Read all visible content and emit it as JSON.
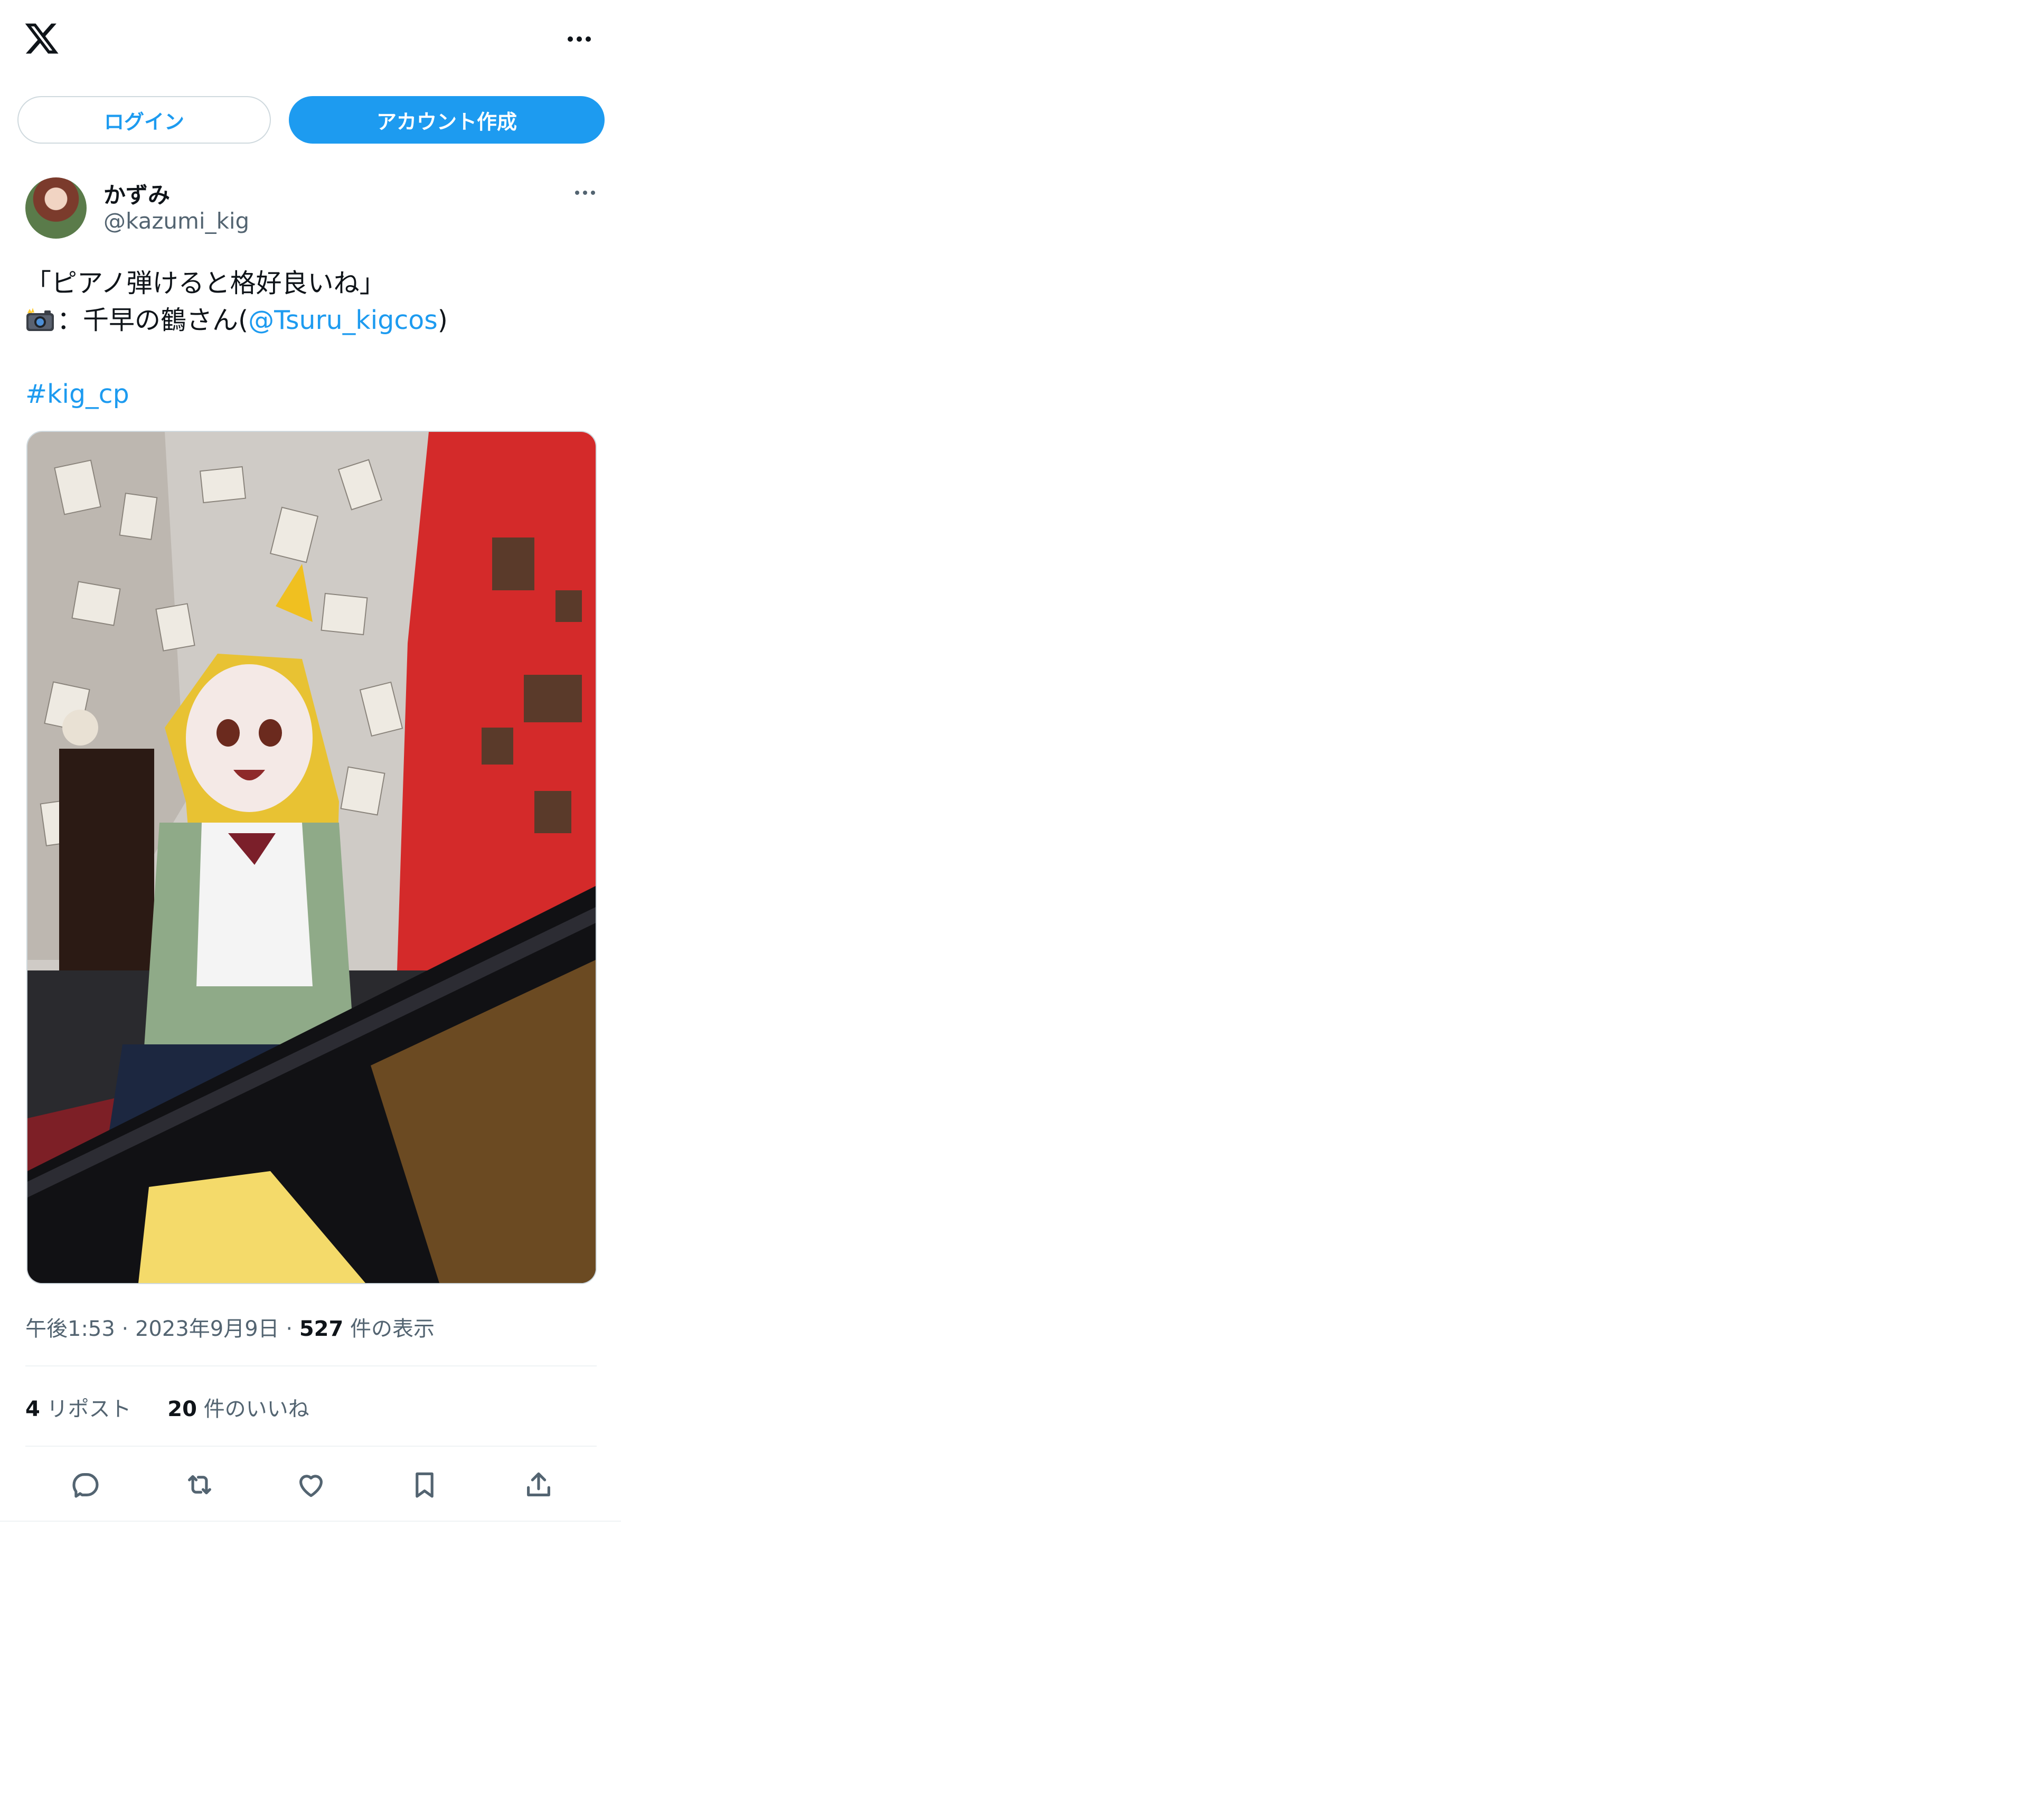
{
  "header": {
    "logo_icon": "x-logo-icon",
    "more_icon": "more-dots-icon"
  },
  "auth": {
    "login_label": "ログイン",
    "signup_label": "アカウント作成"
  },
  "tweet": {
    "author_name": "かずみ",
    "author_handle": "@kazumi_kig",
    "text_line1": "「ピアノ弾けると格好良いね」",
    "text_line2_prefix": "：千早の鶴さん(",
    "mention": "@Tsuru_kigcos",
    "text_line2_suffix": ")",
    "hashtag": "#kig_cp",
    "camera_icon": "camera-flash-icon",
    "time": "午後1:53",
    "date": "2023年9月9日",
    "dot": "·",
    "views_count": "527",
    "views_label": " 件の表示",
    "reposts_count": "4",
    "reposts_label": " リポスト",
    "likes_count": "20",
    "likes_label": " 件のいいね"
  },
  "actions": [
    {
      "icon": "reply-icon"
    },
    {
      "icon": "retweet-icon"
    },
    {
      "icon": "like-icon"
    },
    {
      "icon": "bookmark-icon"
    },
    {
      "icon": "share-icon"
    }
  ],
  "colors": {
    "accent": "#1d9bf0",
    "text": "#0f1419",
    "muted": "#536471",
    "border": "#cfd9de"
  }
}
